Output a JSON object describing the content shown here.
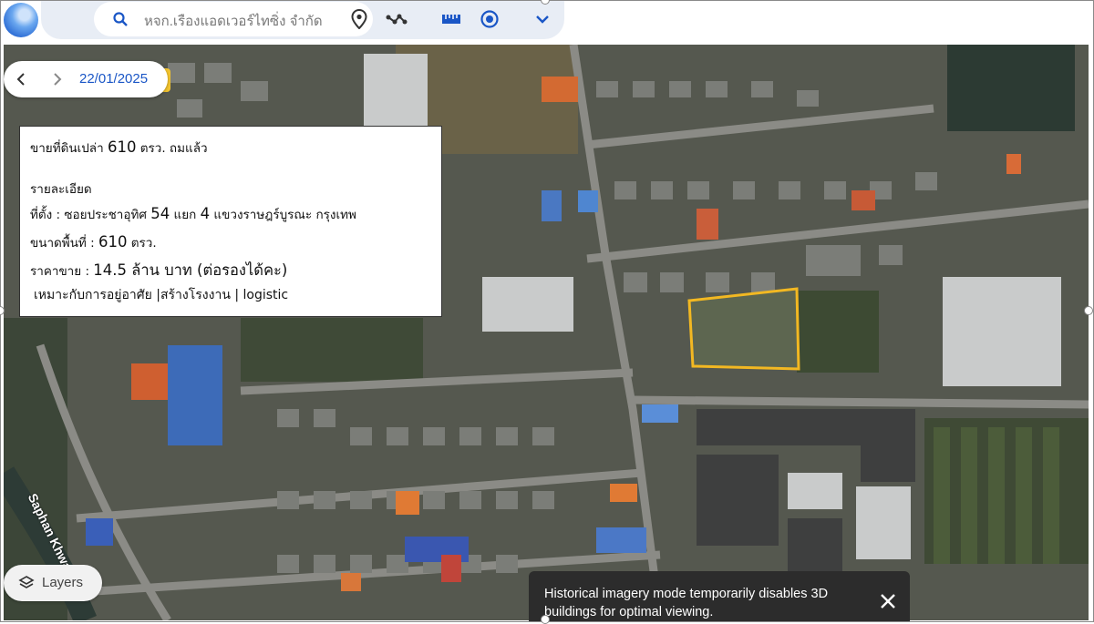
{
  "toolbar": {
    "search_value": "หจก.เรืองแอดเวอร์ไทซิ่ง จำกัด",
    "icons": [
      "search-icon",
      "location-pin-icon",
      "path-icon",
      "ruler-icon",
      "history-icon",
      "chevron-down-icon"
    ]
  },
  "date_control": {
    "date": "22/01/2025"
  },
  "listing": {
    "headline_prefix": "ขายที่ดินเปล่า ",
    "headline_area": "610",
    "headline_suffix": " ตรว. ถมแล้ว",
    "details_heading": "รายละเอียด",
    "location_label": "ที่ตั้ง : ซอยประชาอุทิศ ",
    "location_soi": "54",
    "location_mid": " แยก ",
    "location_branch": "4",
    "location_suffix": " แขวงราษฎร์บูรณะ กรุงเทพ",
    "area_label": "ขนาดพื้นที่ : ",
    "area_value": "610",
    "area_unit": " ตรว.",
    "price_label": "ราคาขาย : ",
    "price_value": "14.5",
    "price_suffix": " ล้าน บาท (ต่อรองได้คะ)",
    "suitable_for": "เหมาะกับการอยู่อาศัย |สร้างโรงงาน | logistic"
  },
  "map": {
    "street_label": "Saphan Khwai",
    "highlight_color": "#f2b822"
  },
  "layers_button": {
    "label": "Layers"
  },
  "notice": {
    "text": "Historical imagery mode temporarily disables 3D buildings for optimal viewing."
  },
  "colors": {
    "accent": "#1a56c6",
    "date_accent": "#f3c42e"
  }
}
